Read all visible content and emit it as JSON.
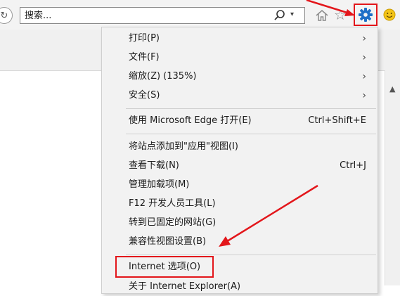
{
  "toolbar": {
    "search_placeholder": "搜索...",
    "search_icon": "magnifier-icon",
    "search_dropdown_icon": "caret-down-icon",
    "icons": [
      "back-icon",
      "home-icon",
      "star-icon",
      "gear-icon",
      "smile-icon"
    ],
    "highlight_color": "#e3161b"
  },
  "menu": {
    "items": [
      {
        "label": "打印(P)",
        "submenu": true
      },
      {
        "label": "文件(F)",
        "submenu": true
      },
      {
        "label": "缩放(Z) (135%)",
        "submenu": true
      },
      {
        "label": "安全(S)",
        "submenu": true
      },
      {
        "label": "使用 Microsoft Edge 打开(E)",
        "shortcut": "Ctrl+Shift+E"
      },
      {
        "label": "将站点添加到\"应用\"视图(I)"
      },
      {
        "label": "查看下载(N)",
        "shortcut": "Ctrl+J"
      },
      {
        "label": "管理加载项(M)"
      },
      {
        "label": "F12 开发人员工具(L)"
      },
      {
        "label": "转到已固定的网站(G)"
      },
      {
        "label": "兼容性视图设置(B)"
      },
      {
        "label": "Internet 选项(O)",
        "highlighted": true
      },
      {
        "label": "关于 Internet Explorer(A)"
      }
    ],
    "arrow_glyph": "›"
  },
  "annotation": {
    "arrow_color": "#e3161b"
  }
}
